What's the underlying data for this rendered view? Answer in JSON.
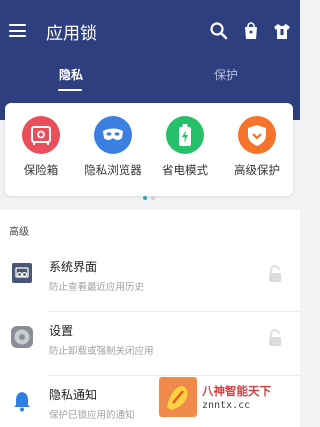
{
  "header": {
    "title": "应用锁",
    "icons": [
      "search-icon",
      "shopping-bag-icon",
      "shirt-icon"
    ]
  },
  "tabs": [
    {
      "label": "隐私",
      "active": true
    },
    {
      "label": "保护",
      "active": false
    }
  ],
  "features": [
    {
      "label": "保险箱",
      "icon": "safe-icon",
      "color": "#e94e5a"
    },
    {
      "label": "隐私浏览器",
      "icon": "mask-icon",
      "color": "#3b7fe0"
    },
    {
      "label": "省电模式",
      "icon": "battery-icon",
      "color": "#27c06a"
    },
    {
      "label": "高级保护",
      "icon": "shield-icon",
      "color": "#f5732a"
    }
  ],
  "pager": {
    "pages": 2,
    "current": 1
  },
  "section": {
    "title": "高级"
  },
  "rows": [
    {
      "title": "系统界面",
      "subtitle": "防止查看最近应用历史",
      "icon": "recent-apps-icon"
    },
    {
      "title": "设置",
      "subtitle": "防止卸载或强制关闭应用",
      "icon": "settings-icon"
    },
    {
      "title": "隐私通知",
      "subtitle": "保护已锁应用的通知",
      "icon": "bell-icon"
    }
  ],
  "watermark": {
    "text": "八神智能天下",
    "url": "znntx.cc"
  },
  "colors": {
    "primary": "#2d3f7e",
    "accent": "#2aa7b8"
  }
}
